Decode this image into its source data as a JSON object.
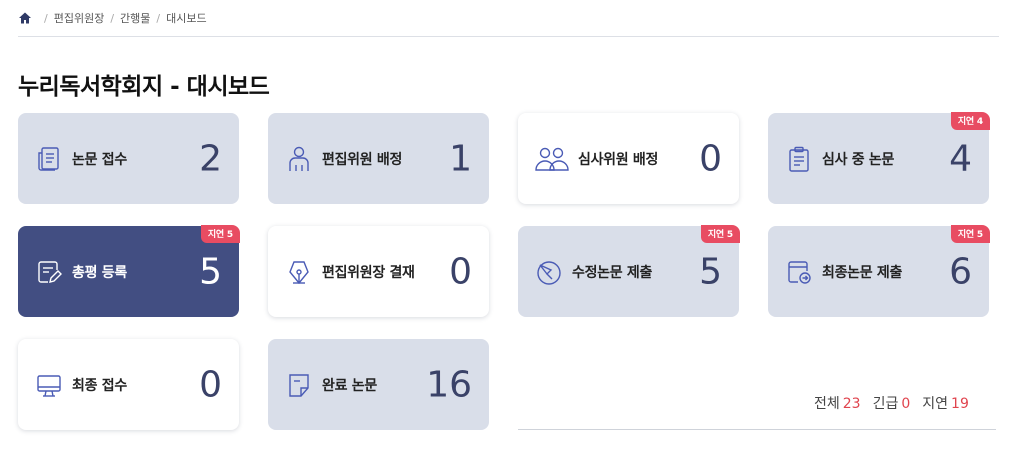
{
  "breadcrumb": {
    "items": [
      "편집위원장",
      "간행물",
      "대시보드"
    ]
  },
  "page_title": "누리독서학회지 - 대시보드",
  "cards": [
    {
      "label": "논문 접수",
      "count": "2",
      "style": "gray",
      "icon": "document-list-icon",
      "badge": ""
    },
    {
      "label": "편집위원 배정",
      "count": "1",
      "style": "gray",
      "icon": "person-icon",
      "badge": ""
    },
    {
      "label": "심사위원 배정",
      "count": "0",
      "style": "white",
      "icon": "people-group-icon",
      "badge": ""
    },
    {
      "label": "심사 중 논문",
      "count": "4",
      "style": "gray",
      "icon": "clipboard-icon",
      "badge": "지연 4"
    },
    {
      "label": "총평 등록",
      "count": "5",
      "style": "navy",
      "icon": "document-edit-icon",
      "badge": "지연 5"
    },
    {
      "label": "편집위원장 결재",
      "count": "0",
      "style": "white",
      "icon": "pen-nib-icon",
      "badge": ""
    },
    {
      "label": "수정논문 제출",
      "count": "5",
      "style": "gray",
      "icon": "pencil-circle-icon",
      "badge": "지연 5"
    },
    {
      "label": "최종논문 제출",
      "count": "6",
      "style": "gray",
      "icon": "document-arrow-icon",
      "badge": "지연 5"
    },
    {
      "label": "최종 접수",
      "count": "0",
      "style": "white",
      "icon": "monitor-icon",
      "badge": ""
    },
    {
      "label": "완료 논문",
      "count": "16",
      "style": "gray",
      "icon": "note-icon",
      "badge": ""
    }
  ],
  "summary": {
    "total_label": "전체",
    "total_value": "23",
    "urgent_label": "긴급",
    "urgent_value": "0",
    "delay_label": "지연",
    "delay_value": "19"
  },
  "colors": {
    "card_gray": "#d9dee9",
    "card_navy": "#424e82",
    "badge_red": "#e84c62",
    "icon_blue": "#4a5bb5",
    "count_text": "#3a4268"
  }
}
